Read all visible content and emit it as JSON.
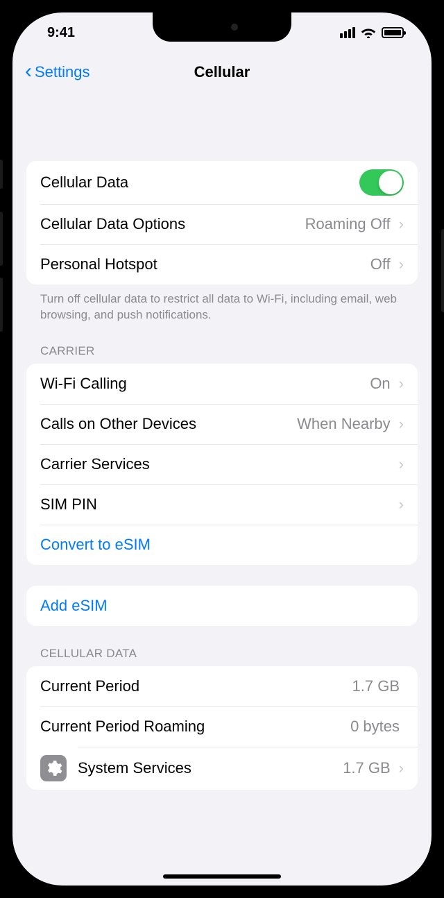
{
  "status": {
    "time": "9:41"
  },
  "nav": {
    "back": "Settings",
    "title": "Cellular"
  },
  "group1": {
    "cellular_data": {
      "label": "Cellular Data",
      "on": true
    },
    "options": {
      "label": "Cellular Data Options",
      "value": "Roaming Off"
    },
    "hotspot": {
      "label": "Personal Hotspot",
      "value": "Off"
    },
    "footer": "Turn off cellular data to restrict all data to Wi-Fi, including email, web browsing, and push notifications."
  },
  "carrier": {
    "header": "Carrier",
    "wifi_calling": {
      "label": "Wi-Fi Calling",
      "value": "On"
    },
    "calls_other": {
      "label": "Calls on Other Devices",
      "value": "When Nearby"
    },
    "carrier_services": {
      "label": "Carrier Services"
    },
    "sim_pin": {
      "label": "SIM PIN"
    },
    "convert_esim": {
      "label": "Convert to eSIM"
    }
  },
  "esim": {
    "add": "Add eSIM"
  },
  "cellular_data": {
    "header": "Cellular Data",
    "current_period": {
      "label": "Current Period",
      "value": "1.7 GB"
    },
    "roaming": {
      "label": "Current Period Roaming",
      "value": "0 bytes"
    },
    "system_services": {
      "label": "System Services",
      "value": "1.7 GB"
    }
  }
}
